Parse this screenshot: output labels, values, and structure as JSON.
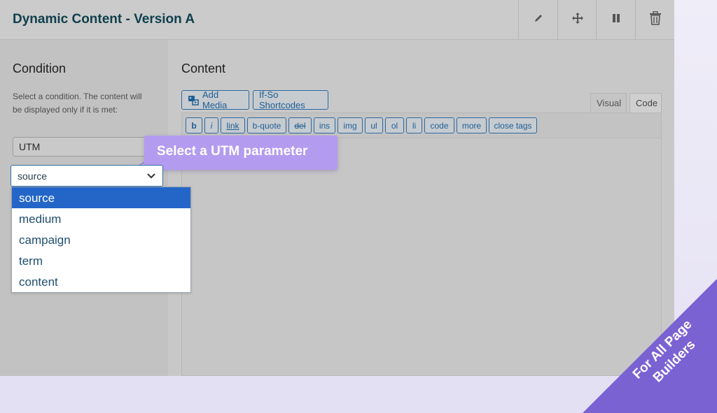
{
  "header": {
    "title": "Dynamic Content - Version A",
    "actions": {
      "edit_icon": "pencil-icon",
      "move_icon": "move-arrows-icon",
      "pause_icon": "pause-icon",
      "delete_icon": "trash-icon"
    }
  },
  "condition": {
    "title": "Condition",
    "description": "Select a condition. The content will be displayed only if it is met:",
    "type_select": {
      "value": "UTM"
    },
    "param_select": {
      "value": "source"
    },
    "options": [
      "source",
      "medium",
      "campaign",
      "term",
      "content"
    ],
    "selected_option": "source"
  },
  "tooltip": {
    "text": "Select a UTM parameter"
  },
  "content": {
    "title": "Content",
    "add_media": "Add Media",
    "shortcodes": "If-So Shortcodes",
    "tabs": {
      "visual": "Visual",
      "code": "Code"
    },
    "quicktags": [
      "b",
      "i",
      "link",
      "b-quote",
      "del",
      "ins",
      "img",
      "ul",
      "ol",
      "li",
      "code",
      "more",
      "close tags"
    ]
  },
  "corner_banner": {
    "line1": "For All Page",
    "line2": "Builders"
  },
  "colors": {
    "accent": "#b39bf0",
    "banner": "#7b62d3",
    "selected": "#2466c8",
    "link_blue": "#1f5e93"
  }
}
